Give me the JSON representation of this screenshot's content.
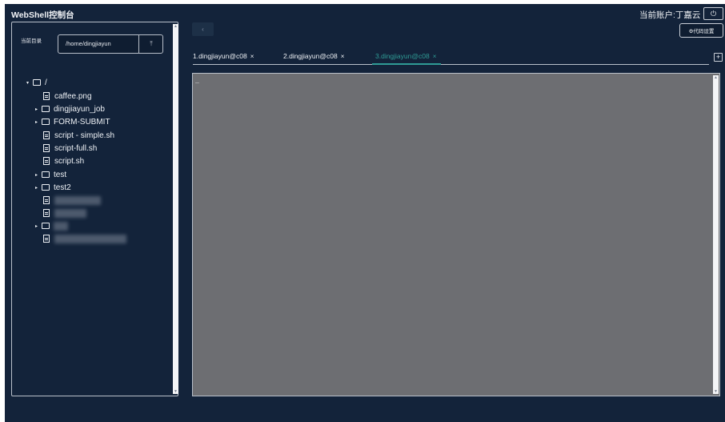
{
  "app": {
    "title": "WebShell控制台"
  },
  "header": {
    "account_label": "当前账户:丁嘉云",
    "power_icon": "power-icon",
    "settings_label": "⚙代码设置"
  },
  "sidebar": {
    "current_dir_label": "当前目录",
    "path_value": "/home/dingjiayun",
    "upload_icon": "upload-icon",
    "tree": [
      {
        "type": "folder",
        "label": "/",
        "expanded": true,
        "depth": 0
      },
      {
        "type": "file",
        "label": "caffee.png",
        "depth": 1
      },
      {
        "type": "folder",
        "label": "dingjiayun_job",
        "expanded": false,
        "depth": 1
      },
      {
        "type": "folder",
        "label": "FORM-SUBMIT",
        "expanded": false,
        "depth": 1
      },
      {
        "type": "file",
        "label": "script - simple.sh",
        "depth": 1
      },
      {
        "type": "file",
        "label": "script-full.sh",
        "depth": 1
      },
      {
        "type": "file",
        "label": "script.sh",
        "depth": 1
      },
      {
        "type": "folder",
        "label": "test",
        "expanded": false,
        "depth": 1
      },
      {
        "type": "folder",
        "label": "test2",
        "expanded": false,
        "depth": 1
      },
      {
        "type": "file",
        "label": "",
        "redacted": true,
        "depth": 1
      },
      {
        "type": "file",
        "label": "",
        "redacted": true,
        "depth": 1
      },
      {
        "type": "folder",
        "label": "",
        "redacted": true,
        "expanded": false,
        "depth": 1
      },
      {
        "type": "file",
        "label": "",
        "redacted": true,
        "depth": 1
      }
    ]
  },
  "terminal": {
    "back_icon": "chevron-left-icon",
    "tabs": [
      {
        "label": "1.dingjiayun@c08",
        "active": false
      },
      {
        "label": "2.dingjiayun@c08",
        "active": false
      },
      {
        "label": "3.dingjiayun@c08",
        "active": true
      }
    ],
    "tab_close_glyph": "×",
    "add_tab_icon": "add-tab-icon",
    "prompt_text": "_",
    "colors": {
      "accent": "#2f9b95",
      "background": "#13233a",
      "terminal_bg": "#6d6e72"
    }
  }
}
